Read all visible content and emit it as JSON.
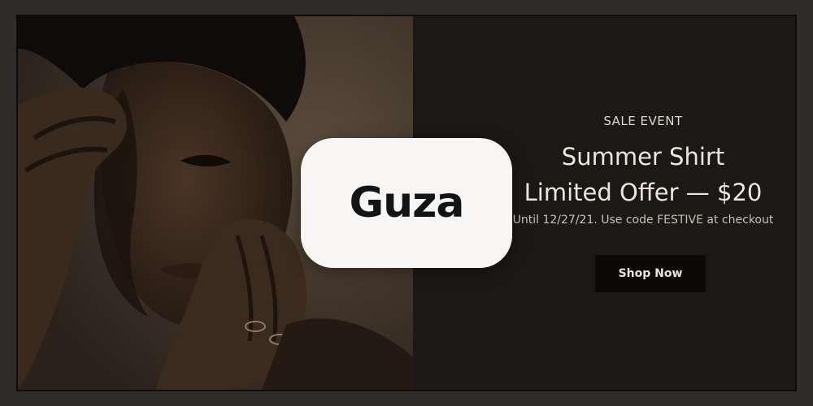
{
  "brand": {
    "logo_text": "Guza"
  },
  "banner": {
    "eyebrow": "SALE EVENT",
    "headline_line1": "Summer Shirt",
    "headline_line2": "Limited Offer — $20",
    "subline": "Until 12/27/21. Use code FESTIVE at checkout",
    "cta_label": "Shop Now"
  },
  "colors": {
    "background": "#2e2b28",
    "overlay": "#1b1815",
    "button": "#0c0a09",
    "logo_card": "#f7f6f4"
  }
}
